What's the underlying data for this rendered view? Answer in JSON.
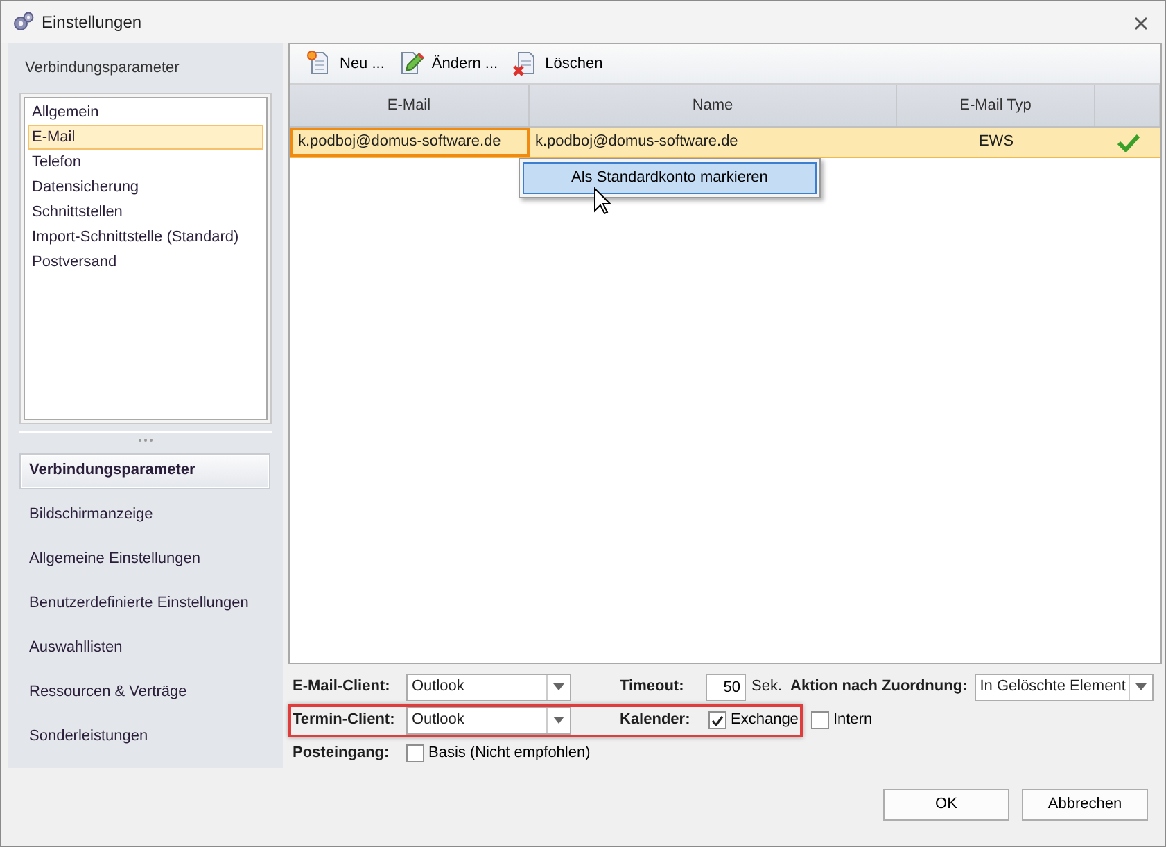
{
  "window": {
    "title": "Einstellungen"
  },
  "sidebar": {
    "header": "Verbindungsparameter",
    "subitems": [
      {
        "label": "Allgemein",
        "selected": false
      },
      {
        "label": "E-Mail",
        "selected": true
      },
      {
        "label": "Telefon",
        "selected": false
      },
      {
        "label": "Datensicherung",
        "selected": false
      },
      {
        "label": "Schnittstellen",
        "selected": false
      },
      {
        "label": "Import-Schnittstelle (Standard)",
        "selected": false
      },
      {
        "label": "Postversand",
        "selected": false
      }
    ],
    "nav": [
      {
        "label": "Verbindungsparameter",
        "selected": true
      },
      {
        "label": "Bildschirmanzeige",
        "selected": false
      },
      {
        "label": "Allgemeine Einstellungen",
        "selected": false
      },
      {
        "label": "Benutzerdefinierte Einstellungen",
        "selected": false
      },
      {
        "label": "Auswahllisten",
        "selected": false
      },
      {
        "label": "Ressourcen & Verträge",
        "selected": false
      },
      {
        "label": "Sonderleistungen",
        "selected": false
      }
    ]
  },
  "toolbar": [
    {
      "label": "Neu ...",
      "kind": "new"
    },
    {
      "label": "Ändern ...",
      "kind": "edit"
    },
    {
      "label": "Löschen",
      "kind": "delete"
    }
  ],
  "table": {
    "columns": [
      "E-Mail",
      "Name",
      "E-Mail Typ"
    ],
    "rows": [
      {
        "email": "k.podboj@domus-software.de",
        "name": "k.podboj@domus-software.de",
        "type": "EWS",
        "default": true,
        "selected": true
      }
    ]
  },
  "context_menu": {
    "items": [
      {
        "label": "Als Standardkonto markieren",
        "selected": true
      }
    ]
  },
  "form": {
    "email_client": {
      "label": "E-Mail-Client:",
      "value": "Outlook"
    },
    "timeout": {
      "label": "Timeout:",
      "value": "50",
      "unit": "Sek."
    },
    "action": {
      "label": "Aktion nach Zuordnung:",
      "value": "In Gelöschte Element"
    },
    "appointment_client": {
      "label": "Termin-Client:",
      "value": "Outlook",
      "highlighted": true
    },
    "calendar": {
      "label": "Kalender:",
      "options": [
        {
          "label": "Exchange",
          "checked": true
        },
        {
          "label": "Intern",
          "checked": false
        }
      ]
    },
    "inbox": {
      "label": "Posteingang:",
      "options": [
        {
          "label": "Basis (Nicht empfohlen)",
          "checked": false
        }
      ]
    }
  },
  "buttons": [
    "OK",
    "Abbrechen"
  ]
}
